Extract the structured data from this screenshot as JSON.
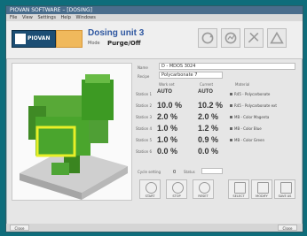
{
  "window": {
    "title": "PIOVAN SOFTWARE – [DOSING]"
  },
  "menu": [
    "File",
    "View",
    "Settings",
    "Help",
    "Windows"
  ],
  "header": {
    "logo_text": "PIOVAN",
    "unit_title": "Dosing unit 3",
    "unit_sub": "Mode",
    "unit_mode": "Purge/Off"
  },
  "form": {
    "name_label": "Name",
    "name_value": "D - MDOS 3024",
    "recipe_label": "Recipe",
    "recipe_value": "Polycarbonate 7",
    "col_mode": "Work set",
    "col_current": "Current",
    "col_material": "Material",
    "rows": [
      {
        "label": "Station 1",
        "v1": "AUTO",
        "v2": "AUTO",
        "material": "R45 - Polycarbonate"
      },
      {
        "label": "Station 2",
        "v1": "10.0 %",
        "v2": "10.2 %",
        "material": "R45 - Polycarbonate ext"
      },
      {
        "label": "Station 3",
        "v1": "2.0 %",
        "v2": "2.0 %",
        "material": "MB - Color Magenta"
      },
      {
        "label": "Station 4",
        "v1": "1.0 %",
        "v2": "1.2 %",
        "material": "MB - Color Blue"
      },
      {
        "label": "Station 5",
        "v1": "1.0 %",
        "v2": "0.9 %",
        "material": "MB - Color Green"
      },
      {
        "label": "Station 6",
        "v1": "0.0 %",
        "v2": "0.0 %",
        "material": ""
      }
    ],
    "cycle_label": "Cycle setting",
    "cycle_value": "0",
    "status_label": "Status"
  },
  "controls": [
    "START",
    "STOP",
    "RESET",
    "SELECT",
    "MODIFY",
    "SAVE AS"
  ],
  "status": {
    "left_button": "Close",
    "right_button": "Close"
  }
}
